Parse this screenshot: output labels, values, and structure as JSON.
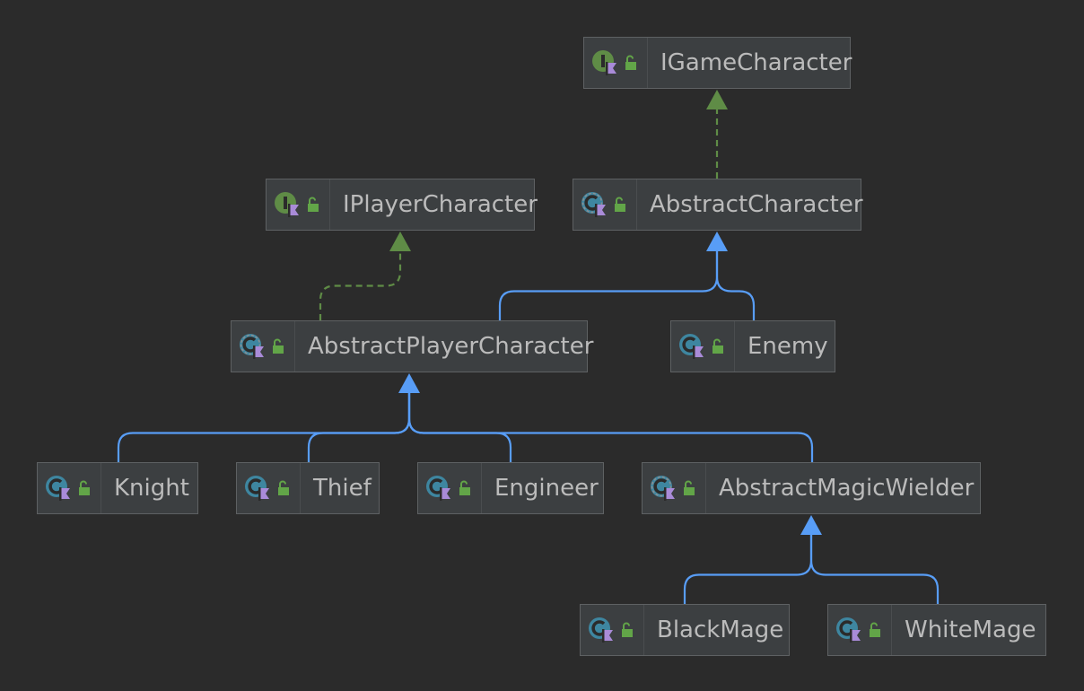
{
  "diagram": {
    "nodes": [
      {
        "id": "IGameCharacter",
        "label": "IGameCharacter",
        "kind": "interface",
        "kind_icon": "interface-icon",
        "visibility_icon": "public-lock-icon"
      },
      {
        "id": "IPlayerCharacter",
        "label": "IPlayerCharacter",
        "kind": "interface",
        "kind_icon": "interface-icon",
        "visibility_icon": "public-lock-icon"
      },
      {
        "id": "AbstractCharacter",
        "label": "AbstractCharacter",
        "kind": "abstract-class",
        "kind_icon": "abstract-class-icon",
        "visibility_icon": "public-lock-icon"
      },
      {
        "id": "AbstractPlayerCharacter",
        "label": "AbstractPlayerCharacter",
        "kind": "abstract-class",
        "kind_icon": "abstract-class-icon",
        "visibility_icon": "public-lock-icon"
      },
      {
        "id": "Enemy",
        "label": "Enemy",
        "kind": "class",
        "kind_icon": "class-icon",
        "visibility_icon": "public-lock-icon"
      },
      {
        "id": "Knight",
        "label": "Knight",
        "kind": "class",
        "kind_icon": "class-icon",
        "visibility_icon": "public-lock-icon"
      },
      {
        "id": "Thief",
        "label": "Thief",
        "kind": "class",
        "kind_icon": "class-icon",
        "visibility_icon": "public-lock-icon"
      },
      {
        "id": "Engineer",
        "label": "Engineer",
        "kind": "class",
        "kind_icon": "class-icon",
        "visibility_icon": "public-lock-icon"
      },
      {
        "id": "AbstractMagicWielder",
        "label": "AbstractMagicWielder",
        "kind": "abstract-class",
        "kind_icon": "abstract-class-icon",
        "visibility_icon": "public-lock-icon"
      },
      {
        "id": "BlackMage",
        "label": "BlackMage",
        "kind": "class",
        "kind_icon": "class-icon",
        "visibility_icon": "public-lock-icon"
      },
      {
        "id": "WhiteMage",
        "label": "WhiteMage",
        "kind": "class",
        "kind_icon": "class-icon",
        "visibility_icon": "public-lock-icon"
      }
    ],
    "edges": [
      {
        "from": "AbstractCharacter",
        "to": "IGameCharacter",
        "type": "implements"
      },
      {
        "from": "AbstractPlayerCharacter",
        "to": "IPlayerCharacter",
        "type": "implements"
      },
      {
        "from": "AbstractPlayerCharacter",
        "to": "AbstractCharacter",
        "type": "extends"
      },
      {
        "from": "Enemy",
        "to": "AbstractCharacter",
        "type": "extends"
      },
      {
        "from": "Knight",
        "to": "AbstractPlayerCharacter",
        "type": "extends"
      },
      {
        "from": "Thief",
        "to": "AbstractPlayerCharacter",
        "type": "extends"
      },
      {
        "from": "Engineer",
        "to": "AbstractPlayerCharacter",
        "type": "extends"
      },
      {
        "from": "AbstractMagicWielder",
        "to": "AbstractPlayerCharacter",
        "type": "extends"
      },
      {
        "from": "BlackMage",
        "to": "AbstractMagicWielder",
        "type": "extends"
      },
      {
        "from": "WhiteMage",
        "to": "AbstractMagicWielder",
        "type": "extends"
      }
    ]
  },
  "colors": {
    "background": "#2b2b2b",
    "node_fill": "#3c3f41",
    "node_border": "#5e6163",
    "label_text": "#bbbbbb",
    "extends_edge": "#589df6",
    "implements_edge": "#5f8c46",
    "interface_icon": "#5f8c46",
    "class_icon": "#3e86a0",
    "flag_icon": "#a98bd8",
    "lock_icon": "#62a548"
  }
}
